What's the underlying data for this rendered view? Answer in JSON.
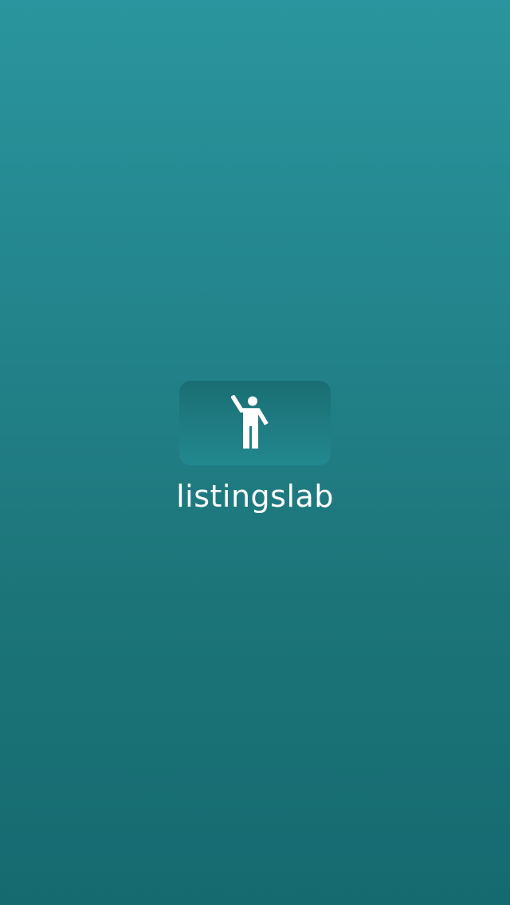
{
  "splash": {
    "brand_name": "listingslab",
    "logo_icon": "person-waving-icon"
  },
  "colors": {
    "background_top": "#2a959e",
    "background_bottom": "#156a70",
    "badge_top": "#196e73",
    "badge_bottom": "#23888f",
    "foreground": "#ffffff"
  }
}
